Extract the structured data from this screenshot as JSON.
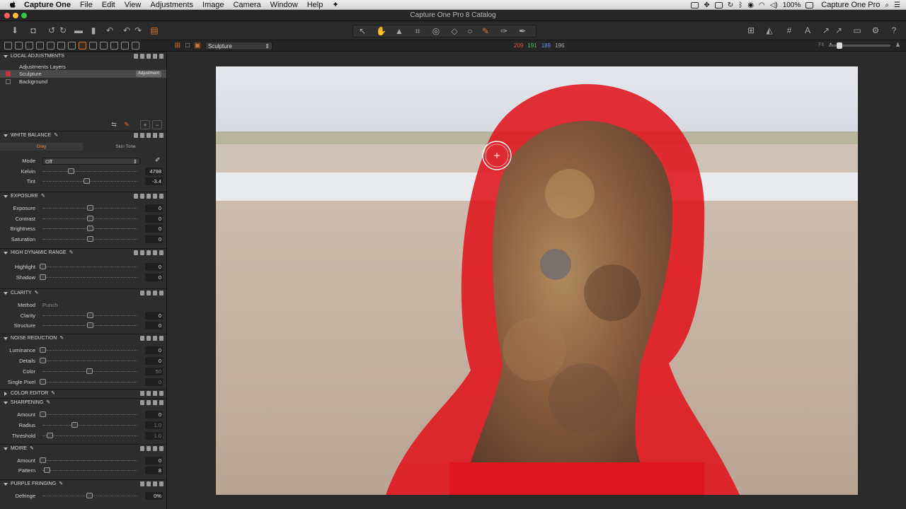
{
  "menubar": {
    "app_name": "Capture One",
    "items": [
      "File",
      "Edit",
      "View",
      "Adjustments",
      "Image",
      "Camera",
      "Window",
      "Help"
    ],
    "battery": "100%",
    "right_app_name": "Capture One Pro"
  },
  "window": {
    "title": "Capture One Pro 8 Catalog"
  },
  "subbar": {
    "variant_name": "Sculpture",
    "rgb": {
      "r": "209",
      "g": "191",
      "b": "189",
      "l": "196"
    },
    "fit_label": "Fit"
  },
  "local_adjustments": {
    "title": "LOCAL ADJUSTMENTS",
    "header": "Adjustments Layers",
    "layers": [
      {
        "name": "Sculpture",
        "badge": "Adjustment",
        "selected": true
      },
      {
        "name": "Background",
        "selected": false
      }
    ]
  },
  "white_balance": {
    "title": "WHITE BALANCE",
    "tabs": [
      "Grey",
      "Skin Tone"
    ],
    "mode_label": "Mode",
    "mode_value": "Off",
    "kelvin_label": "Kelvin",
    "kelvin_value": "4798",
    "tint_label": "Tint",
    "tint_value": "-3.4"
  },
  "exposure": {
    "title": "EXPOSURE",
    "rows": [
      {
        "label": "Exposure",
        "value": "0"
      },
      {
        "label": "Contrast",
        "value": "0"
      },
      {
        "label": "Brightness",
        "value": "0"
      },
      {
        "label": "Saturation",
        "value": "0"
      }
    ]
  },
  "hdr": {
    "title": "HIGH DYNAMIC RANGE",
    "rows": [
      {
        "label": "Highlight",
        "value": "0"
      },
      {
        "label": "Shadow",
        "value": "0"
      }
    ]
  },
  "clarity": {
    "title": "CLARITY",
    "method_label": "Method",
    "method_value": "Punch",
    "rows": [
      {
        "label": "Clarity",
        "value": "0"
      },
      {
        "label": "Structure",
        "value": "0"
      }
    ]
  },
  "noise_reduction": {
    "title": "NOISE REDUCTION",
    "rows": [
      {
        "label": "Luminance",
        "value": "0"
      },
      {
        "label": "Details",
        "value": "0"
      },
      {
        "label": "Color",
        "value": "50"
      },
      {
        "label": "Single Pixel",
        "value": "0"
      }
    ]
  },
  "color_editor": {
    "title": "COLOR EDITOR"
  },
  "sharpening": {
    "title": "SHARPENING",
    "rows": [
      {
        "label": "Amount",
        "value": "0"
      },
      {
        "label": "Radius",
        "value": "1.0"
      },
      {
        "label": "Threshold",
        "value": "1.0"
      }
    ]
  },
  "moire": {
    "title": "MOIRE",
    "rows": [
      {
        "label": "Amount",
        "value": "0"
      },
      {
        "label": "Pattern",
        "value": "8"
      }
    ]
  },
  "purple_fringing": {
    "title": "PURPLE FRINGING",
    "rows": [
      {
        "label": "Defringe",
        "value": "0%"
      }
    ]
  },
  "colors": {
    "accent": "#e0762a",
    "mask": "#e0141e"
  }
}
